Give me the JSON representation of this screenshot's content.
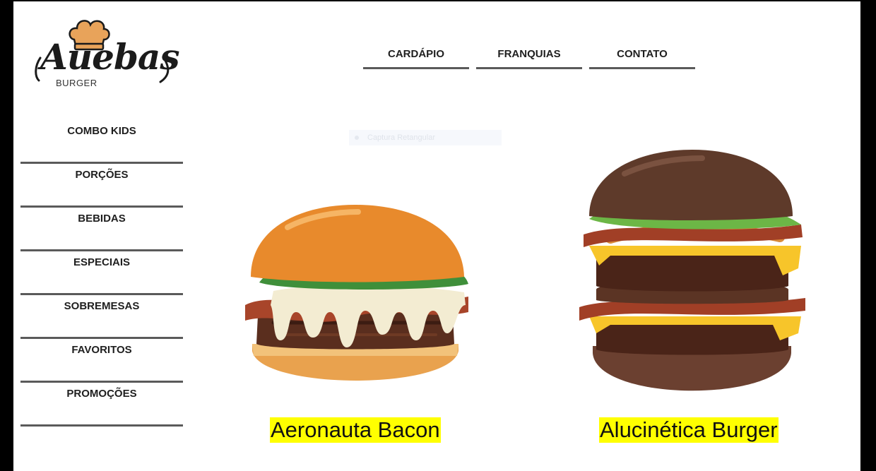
{
  "brand": {
    "name": "Auebas",
    "subtitle": "BURGER"
  },
  "top_nav": {
    "items": [
      {
        "label": "CARDÁPIO"
      },
      {
        "label": "FRANQUIAS"
      },
      {
        "label": "CONTATO"
      }
    ]
  },
  "sidebar": {
    "items": [
      {
        "label": "COMBO KIDS"
      },
      {
        "label": "PORÇÕES"
      },
      {
        "label": "BEBIDAS"
      },
      {
        "label": "ESPECIAIS"
      },
      {
        "label": "SOBREMESAS"
      },
      {
        "label": "FAVORITOS"
      },
      {
        "label": "PROMOÇÕES"
      }
    ]
  },
  "overlay": {
    "label": "Captura Retangular"
  },
  "products": [
    {
      "name": "Aeronauta Bacon",
      "image": "burger-bacon-icon"
    },
    {
      "name": "Alucinética Burger",
      "image": "burger-double-icon"
    }
  ],
  "colors": {
    "highlight": "#ffff00",
    "nav_underline": "#5a5a5a",
    "page_background": "#ffffff",
    "frame": "#000000"
  }
}
